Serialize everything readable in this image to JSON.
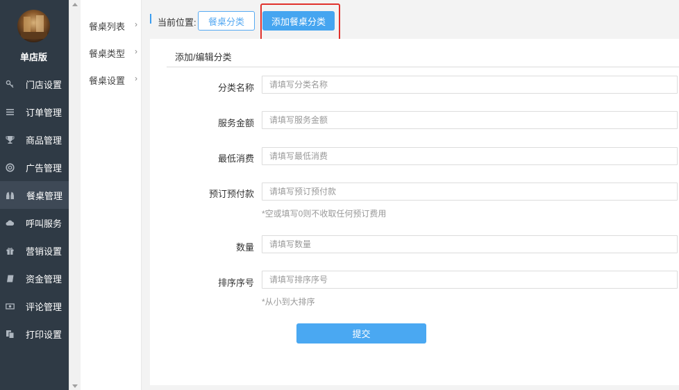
{
  "sidebar": {
    "store_name": "单店版",
    "items": [
      {
        "label": "门店设置",
        "icon": "key-icon"
      },
      {
        "label": "订单管理",
        "icon": "list-icon"
      },
      {
        "label": "商品管理",
        "icon": "trophy-icon"
      },
      {
        "label": "广告管理",
        "icon": "lifebuoy-icon"
      },
      {
        "label": "餐桌管理",
        "icon": "binoculars-icon",
        "active": true
      },
      {
        "label": "呼叫服务",
        "icon": "cloud-icon"
      },
      {
        "label": "营销设置",
        "icon": "gift-icon"
      },
      {
        "label": "资金管理",
        "icon": "book-icon"
      },
      {
        "label": "评论管理",
        "icon": "money-icon"
      },
      {
        "label": "打印设置",
        "icon": "copy-icon"
      }
    ]
  },
  "submenu": {
    "items": [
      {
        "label": "餐桌列表"
      },
      {
        "label": "餐桌类型"
      },
      {
        "label": "餐桌设置"
      }
    ]
  },
  "breadcrumb": {
    "label": "当前位置:",
    "category_button": "餐桌分类",
    "add_button": "添加餐桌分类"
  },
  "panel": {
    "title": "添加/编辑分类"
  },
  "form": {
    "name": {
      "label": "分类名称",
      "placeholder": "请填写分类名称"
    },
    "service_fee": {
      "label": "服务金额",
      "placeholder": "请填写服务金额"
    },
    "min_spend": {
      "label": "最低消费",
      "placeholder": "请填写最低消费"
    },
    "deposit": {
      "label": "预订预付款",
      "placeholder": "请填写预订预付款",
      "hint": "*空或填写0则不收取任何预订费用"
    },
    "quantity": {
      "label": "数量",
      "placeholder": "请填写数量"
    },
    "sort": {
      "label": "排序序号",
      "placeholder": "请填写排序序号",
      "hint": "*从小到大排序"
    },
    "submit": "提交"
  },
  "colors": {
    "sidebar_bg": "#2f3a45",
    "accent": "#45a5f0",
    "highlight_border": "#e0302b"
  }
}
